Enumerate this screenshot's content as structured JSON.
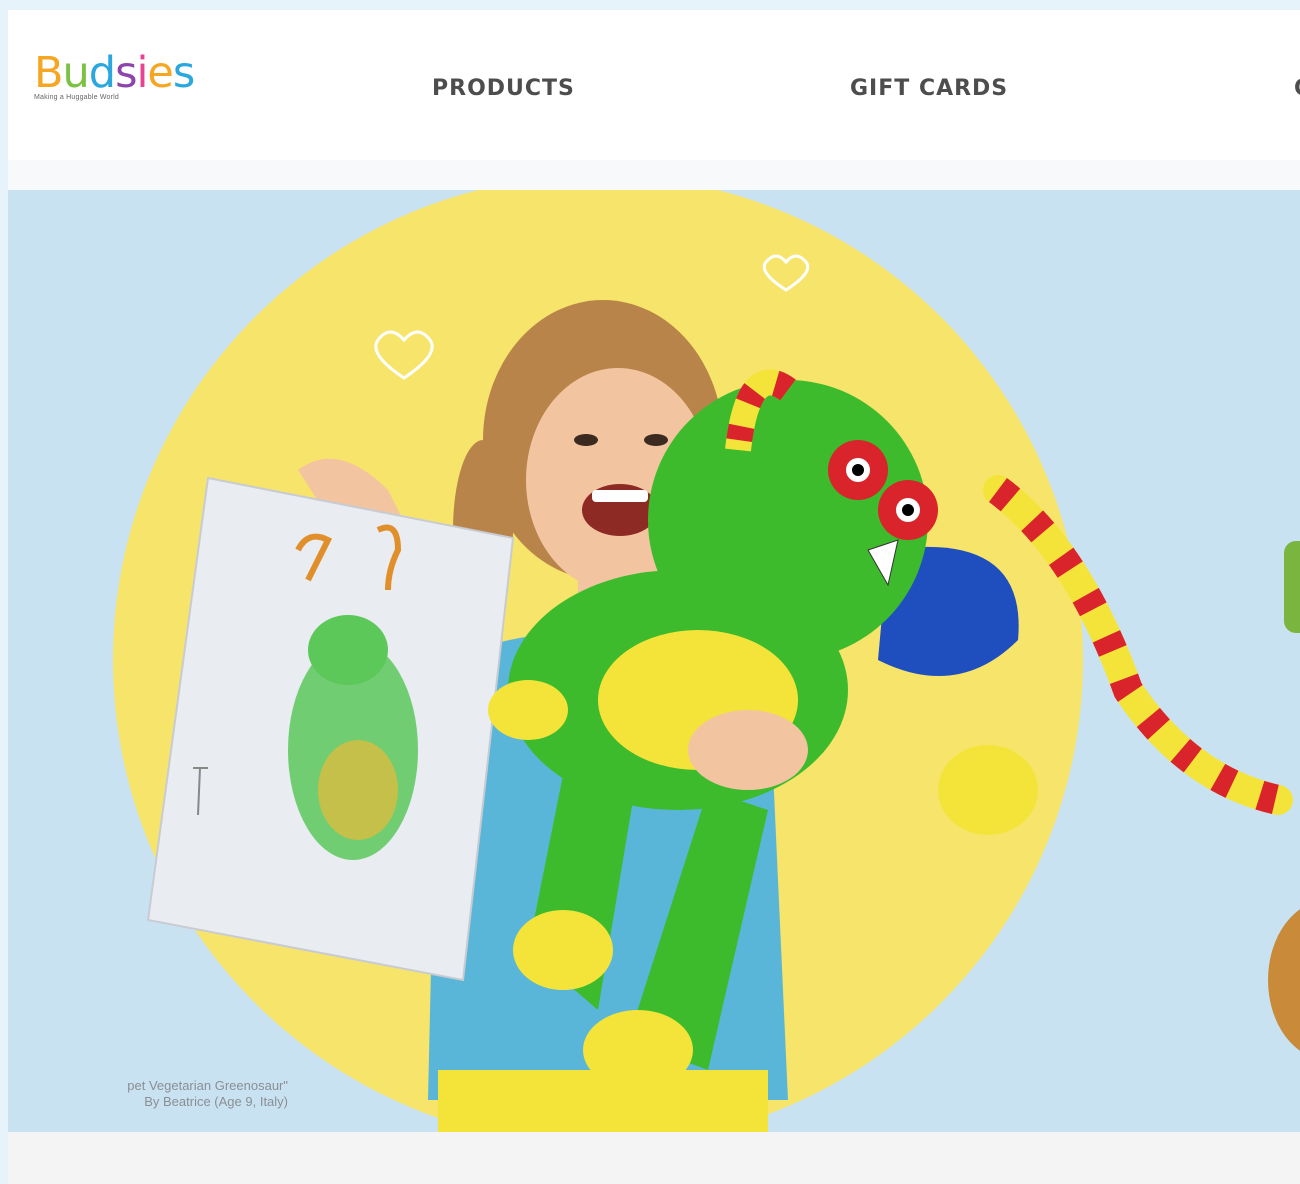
{
  "header": {
    "logo": {
      "wordmark": "Budsies",
      "tagline": "Making a Huggable World",
      "letter_colors": [
        "#f5a623",
        "#7cc242",
        "#2aa7df",
        "#8e44ad",
        "#e84393",
        "#f5a623",
        "#2aa7df"
      ]
    },
    "nav": [
      {
        "label": "PRODUCTS"
      },
      {
        "label": "GIFT CARDS"
      },
      {
        "label": "G"
      }
    ]
  },
  "hero": {
    "caption_line1": "pet Vegetarian Greenosaur\"",
    "caption_line2": "By Beatrice (Age 9, Italy)",
    "colors": {
      "background": "#c9e2f2",
      "circle": "#f7e46a",
      "plush_green": "#3dbb2c",
      "plush_yellow": "#f4e43a",
      "accent_red": "#d8242a",
      "shirt_blue": "#5ab6d8",
      "cta_green": "#7ab53f"
    },
    "images": [
      {
        "name": "girl-with-drawing-photo"
      },
      {
        "name": "green-monster-plush"
      },
      {
        "name": "child-drawing-paper"
      }
    ]
  }
}
